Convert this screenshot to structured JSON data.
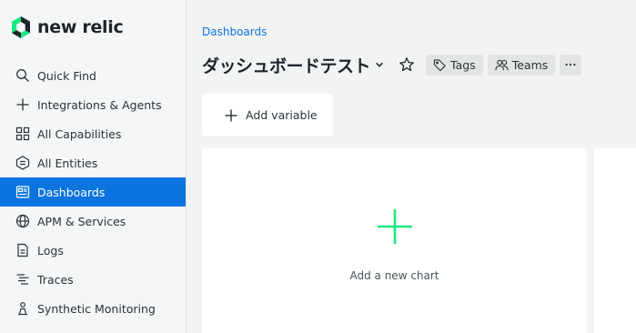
{
  "brand": {
    "name": "new relic",
    "accent": "#0c74df",
    "logo_green": "#1ce783",
    "logo_dark": "#1d252c"
  },
  "sidebar": {
    "items": [
      {
        "label": "Quick Find",
        "icon": "search-icon"
      },
      {
        "label": "Integrations & Agents",
        "icon": "plus-icon"
      },
      {
        "label": "All Capabilities",
        "icon": "grid-icon"
      },
      {
        "label": "All Entities",
        "icon": "hexagon-list-icon"
      },
      {
        "label": "Dashboards",
        "icon": "dashboard-icon",
        "active": true
      },
      {
        "label": "APM & Services",
        "icon": "globe-icon"
      },
      {
        "label": "Logs",
        "icon": "document-icon"
      },
      {
        "label": "Traces",
        "icon": "traces-icon"
      },
      {
        "label": "Synthetic Monitoring",
        "icon": "synthetic-robot-icon"
      }
    ]
  },
  "main": {
    "breadcrumb": "Dashboards",
    "title": "ダッシュボードテスト",
    "tags_label": "Tags",
    "teams_label": "Teams",
    "add_variable_label": "Add variable",
    "add_chart_label": "Add a new chart"
  }
}
